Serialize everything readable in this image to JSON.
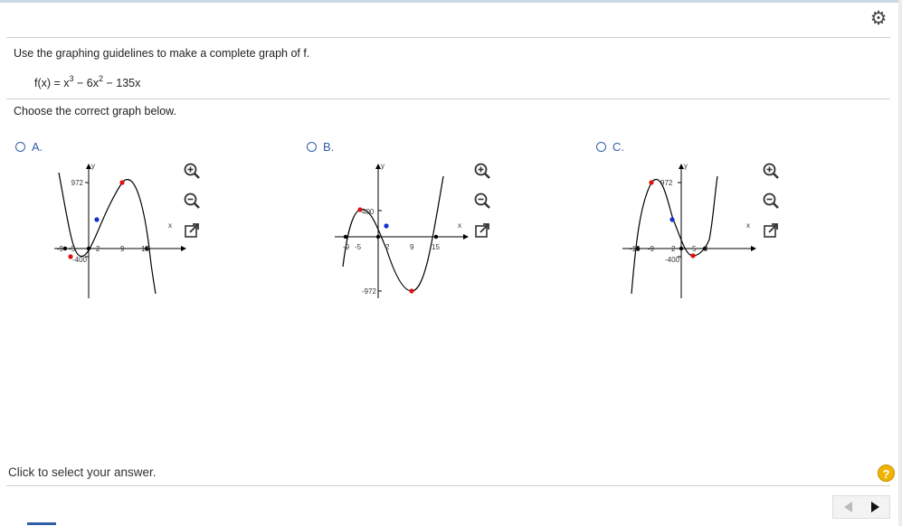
{
  "instruction": "Use the graphing guidelines to make a complete graph of f.",
  "function": {
    "lhs": "f(x) = x",
    "exp1": "3",
    "mid": " − 6x",
    "exp2": "2",
    "tail": " − 135x"
  },
  "prompt": "Choose the correct graph below.",
  "options": [
    {
      "label": "A.",
      "y_axis_label": "y",
      "x_axis_label": "x",
      "y_tick_labels": [
        "972",
        "-400"
      ],
      "x_tick_labels": [
        "-9",
        "-5",
        "2",
        "9",
        "15"
      ]
    },
    {
      "label": "B.",
      "y_axis_label": "y",
      "x_axis_label": "x",
      "y_tick_labels": [
        "400",
        "-972"
      ],
      "x_tick_labels": [
        "-9",
        "-5",
        "2",
        "9",
        "15"
      ]
    },
    {
      "label": "C.",
      "y_axis_label": "y",
      "x_axis_label": "x",
      "y_tick_labels": [
        "972",
        "-400"
      ],
      "x_tick_labels": [
        "-15",
        "-9",
        "2",
        "5",
        "9"
      ]
    }
  ],
  "tools": {
    "zoom_in": "zoom-in",
    "zoom_out": "zoom-out",
    "open_new_window": "open-in-new-window"
  },
  "status": "Click to select your answer.",
  "help": "?",
  "icons": {
    "settings": "gear-icon"
  },
  "colors": {
    "accent": "#2f5ea8",
    "extremum_point": "#e01010",
    "inflection_point": "#1030d0",
    "help": "#f0b400"
  }
}
